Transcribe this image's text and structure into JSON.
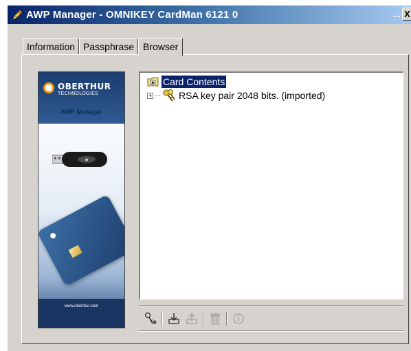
{
  "window": {
    "title": "AWP Manager - OMNIKEY CardMan 6121 0",
    "title_icon": "pen-icon",
    "ellipsis": "...",
    "close_label": "X"
  },
  "tabs": [
    {
      "label": "Information",
      "active": false
    },
    {
      "label": "Passphrase",
      "active": false
    },
    {
      "label": "Browser",
      "active": true
    }
  ],
  "banner": {
    "brand": "OBERTHUR",
    "brand_sub": "TECHNOLOGIES",
    "product": "AWP Manager",
    "url": "www.oberthur.com"
  },
  "tree": {
    "root": {
      "label": "Card Contents",
      "icon": "folder-icon",
      "selected": true
    },
    "items": [
      {
        "label": "RSA key pair 2048 bits. (imported)",
        "icon": "key-icon",
        "expander": "+"
      }
    ]
  },
  "toolbar": {
    "buttons": [
      {
        "name": "generate-key",
        "icon": "key-generate-icon",
        "enabled": true
      },
      {
        "name": "import",
        "icon": "import-icon",
        "enabled": true
      },
      {
        "name": "export",
        "icon": "export-icon",
        "enabled": false
      },
      {
        "name": "delete",
        "icon": "trash-icon",
        "enabled": false
      },
      {
        "name": "properties",
        "icon": "info-icon",
        "enabled": false
      }
    ]
  },
  "colors": {
    "title_gradient_start": "#0a246a",
    "selection": "#0a246a",
    "face": "#d6d3ce",
    "brand_blue": "#1c3d70"
  }
}
